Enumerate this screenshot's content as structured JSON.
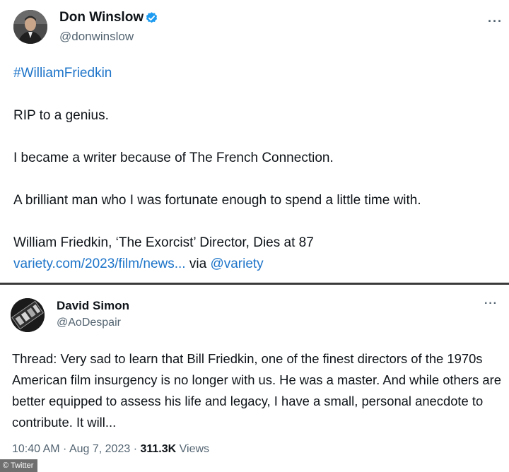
{
  "tweet1": {
    "author_name": "Don Winslow",
    "author_handle": "@donwinslow",
    "hashtag": "#WilliamFriedkin",
    "line1": "RIP to a genius.",
    "line2": "I became a writer because of The French Connection.",
    "line3": "A brilliant man who I was fortunate enough to spend a little time with.",
    "article_title": "William Friedkin, ‘The Exorcist’ Director, Dies at 87",
    "article_link": "variety.com/2023/film/news...",
    "via_text": " via ",
    "via_handle": "@variety",
    "more_label": "···",
    "verified_icon": "verified-badge-icon",
    "verified_color": "#1d9bf0"
  },
  "tweet2": {
    "author_name": "David Simon",
    "author_handle": "@AoDespair",
    "body": "Thread: Very sad to learn that Bill Friedkin, one of the finest directors of the 1970s American film insurgency is no longer with us. He was a master. And while others are better equipped to assess his life and legacy, I have a small, personal anecdote to contribute. It will...",
    "time": "10:40 AM",
    "date": "Aug 7, 2023",
    "views_count": "311.3K",
    "views_label": "Views",
    "dot": " · ",
    "more_label": "···"
  },
  "watermark": "© Twitter",
  "colors": {
    "link": "#1d74c9",
    "secondary_text": "#536471",
    "separator": "#3a3a3a"
  }
}
